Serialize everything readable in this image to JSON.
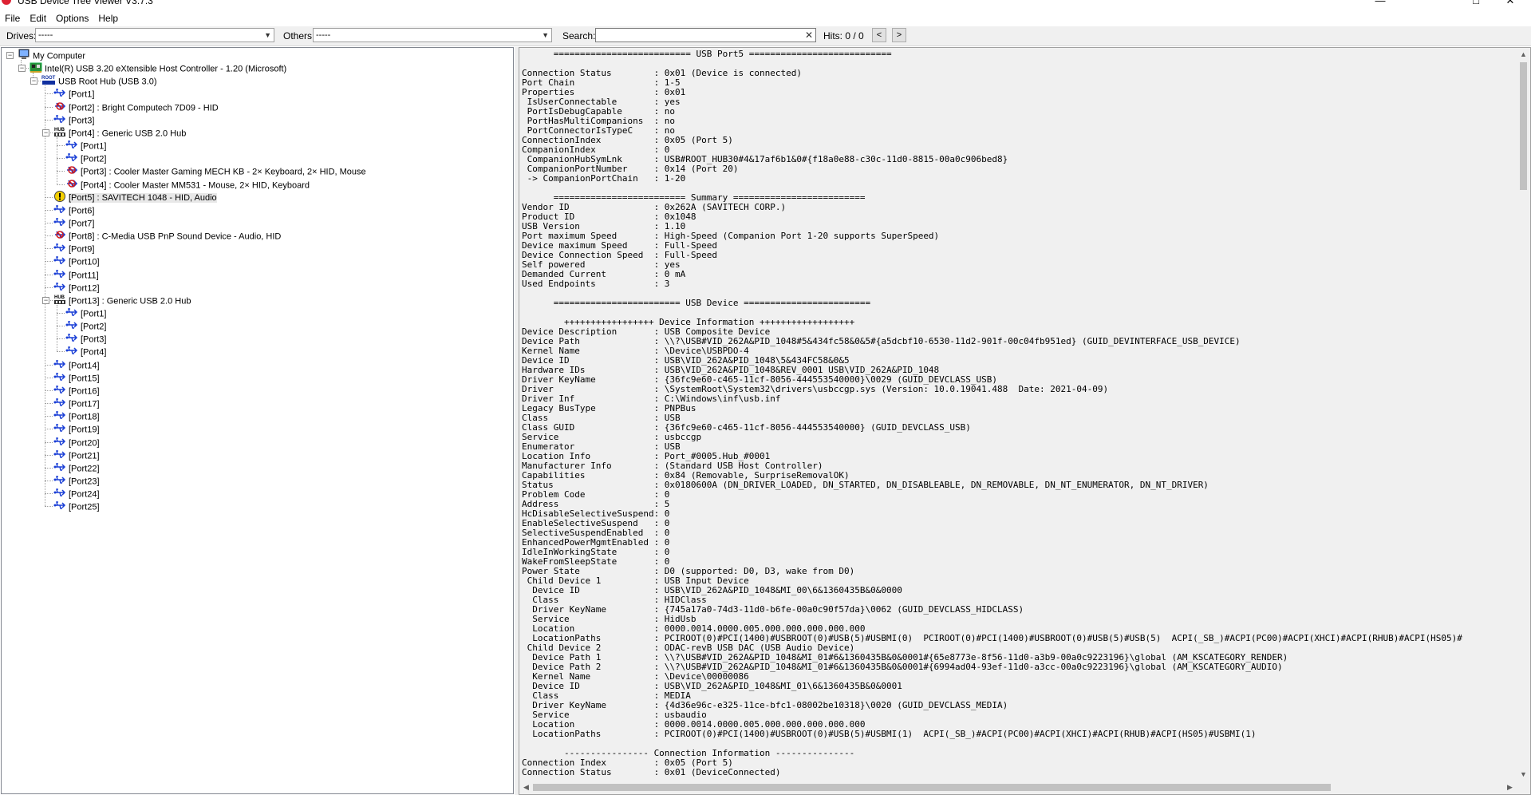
{
  "window": {
    "title": "USB Device Tree Viewer V3.7.3",
    "minimize": "—",
    "maximize": "□",
    "close": "✕"
  },
  "menu": [
    "File",
    "Edit",
    "Options",
    "Help"
  ],
  "toolbar": {
    "drives_label": "Drives:",
    "drives_value": "-----",
    "others_label": "Others:",
    "others_value": "-----",
    "search_label": "Search:",
    "search_value": "",
    "search_clear": "✕",
    "hits_text": "Hits: 0 / 0",
    "prev": "<",
    "next": ">"
  },
  "tree": [
    {
      "level": 0,
      "icon": "computer-icon",
      "label": "My Computer",
      "expanded": true
    },
    {
      "level": 1,
      "icon": "pci-controller-icon",
      "label": "Intel(R) USB 3.20 eXtensible Host Controller - 1.20 (Microsoft)",
      "expanded": true
    },
    {
      "level": 2,
      "icon": "root-hub-icon",
      "label": "USB Root Hub (USB 3.0)",
      "expanded": true
    },
    {
      "level": 3,
      "icon": "usb-port-icon",
      "label": "[Port1]"
    },
    {
      "level": 3,
      "icon": "usb-device-icon",
      "label": "[Port2] : Bright Computech 7D09 - HID"
    },
    {
      "level": 3,
      "icon": "usb-port-icon",
      "label": "[Port3]"
    },
    {
      "level": 3,
      "icon": "usb-hub-icon",
      "label": "[Port4] : Generic USB 2.0 Hub",
      "expanded": true
    },
    {
      "level": 4,
      "icon": "usb-port-icon",
      "label": "[Port1]"
    },
    {
      "level": 4,
      "icon": "usb-port-icon",
      "label": "[Port2]"
    },
    {
      "level": 4,
      "icon": "usb-device-icon",
      "label": "[Port3] : Cooler Master Gaming MECH KB - 2× Keyboard, 2× HID, Mouse"
    },
    {
      "level": 4,
      "icon": "usb-device-icon",
      "label": "[Port4] : Cooler Master MM531 - Mouse, 2× HID, Keyboard"
    },
    {
      "level": 3,
      "icon": "warning-icon",
      "label": "[Port5] : SAVITECH 1048 - HID, Audio",
      "selected": true
    },
    {
      "level": 3,
      "icon": "usb-port-icon",
      "label": "[Port6]"
    },
    {
      "level": 3,
      "icon": "usb-port-icon",
      "label": "[Port7]"
    },
    {
      "level": 3,
      "icon": "usb-device-icon",
      "label": "[Port8] : C-Media USB PnP Sound Device - Audio, HID"
    },
    {
      "level": 3,
      "icon": "usb-port-icon",
      "label": "[Port9]"
    },
    {
      "level": 3,
      "icon": "usb-port-icon",
      "label": "[Port10]"
    },
    {
      "level": 3,
      "icon": "usb-port-icon",
      "label": "[Port11]"
    },
    {
      "level": 3,
      "icon": "usb-port-icon",
      "label": "[Port12]"
    },
    {
      "level": 3,
      "icon": "usb-hub-icon",
      "label": "[Port13] : Generic USB 2.0 Hub",
      "expanded": true
    },
    {
      "level": 4,
      "icon": "usb-port-icon",
      "label": "[Port1]"
    },
    {
      "level": 4,
      "icon": "usb-port-icon",
      "label": "[Port2]"
    },
    {
      "level": 4,
      "icon": "usb-port-icon",
      "label": "[Port3]"
    },
    {
      "level": 4,
      "icon": "usb-port-icon",
      "label": "[Port4]"
    },
    {
      "level": 3,
      "icon": "usb-port-icon",
      "label": "[Port14]"
    },
    {
      "level": 3,
      "icon": "usb-port-icon",
      "label": "[Port15]"
    },
    {
      "level": 3,
      "icon": "usb-port-icon",
      "label": "[Port16]"
    },
    {
      "level": 3,
      "icon": "usb-port-icon",
      "label": "[Port17]"
    },
    {
      "level": 3,
      "icon": "usb-port-icon",
      "label": "[Port18]"
    },
    {
      "level": 3,
      "icon": "usb-port-icon",
      "label": "[Port19]"
    },
    {
      "level": 3,
      "icon": "usb-port-icon",
      "label": "[Port20]"
    },
    {
      "level": 3,
      "icon": "usb-port-icon",
      "label": "[Port21]"
    },
    {
      "level": 3,
      "icon": "usb-port-icon",
      "label": "[Port22]"
    },
    {
      "level": 3,
      "icon": "usb-port-icon",
      "label": "[Port23]"
    },
    {
      "level": 3,
      "icon": "usb-port-icon",
      "label": "[Port24]"
    },
    {
      "level": 3,
      "icon": "usb-port-icon",
      "label": "[Port25]"
    }
  ],
  "info_lines": [
    "      ========================== USB Port5 ===========================",
    "",
    "Connection Status        : 0x01 (Device is connected)",
    "Port Chain               : 1-5",
    "Properties               : 0x01",
    " IsUserConnectable       : yes",
    " PortIsDebugCapable      : no",
    " PortHasMultiCompanions  : no",
    " PortConnectorIsTypeC    : no",
    "ConnectionIndex          : 0x05 (Port 5)",
    "CompanionIndex           : 0",
    " CompanionHubSymLnk      : USB#ROOT_HUB30#4&17af6b1&0#{f18a0e88-c30c-11d0-8815-00a0c906bed8}",
    " CompanionPortNumber     : 0x14 (Port 20)",
    " -> CompanionPortChain   : 1-20",
    "",
    "      ========================= Summary =========================",
    "Vendor ID                : 0x262A (SAVITECH CORP.)",
    "Product ID               : 0x1048",
    "USB Version              : 1.10",
    "Port maximum Speed       : High-Speed (Companion Port 1-20 supports SuperSpeed)",
    "Device maximum Speed     : Full-Speed",
    "Device Connection Speed  : Full-Speed",
    "Self powered             : yes",
    "Demanded Current         : 0 mA",
    "Used Endpoints           : 3",
    "",
    "      ======================== USB Device ========================",
    "",
    "        +++++++++++++++++ Device Information ++++++++++++++++++",
    "Device Description       : USB Composite Device",
    "Device Path              : \\\\?\\USB#VID_262A&PID_1048#5&434fc58&0&5#{a5dcbf10-6530-11d2-901f-00c04fb951ed} (GUID_DEVINTERFACE_USB_DEVICE)",
    "Kernel Name              : \\Device\\USBPDO-4",
    "Device ID                : USB\\VID_262A&PID_1048\\5&434FC58&0&5",
    "Hardware IDs             : USB\\VID_262A&PID_1048&REV_0001 USB\\VID_262A&PID_1048",
    "Driver KeyName           : {36fc9e60-c465-11cf-8056-444553540000}\\0029 (GUID_DEVCLASS_USB)",
    "Driver                   : \\SystemRoot\\System32\\drivers\\usbccgp.sys (Version: 10.0.19041.488  Date: 2021-04-09)",
    "Driver Inf               : C:\\Windows\\inf\\usb.inf",
    "Legacy BusType           : PNPBus",
    "Class                    : USB",
    "Class GUID               : {36fc9e60-c465-11cf-8056-444553540000} (GUID_DEVCLASS_USB)",
    "Service                  : usbccgp",
    "Enumerator               : USB",
    "Location Info            : Port_#0005.Hub_#0001",
    "Manufacturer Info        : (Standard USB Host Controller)",
    "Capabilities             : 0x84 (Removable, SurpriseRemovalOK)",
    "Status                   : 0x0180600A (DN_DRIVER_LOADED, DN_STARTED, DN_DISABLEABLE, DN_REMOVABLE, DN_NT_ENUMERATOR, DN_NT_DRIVER)",
    "Problem Code             : 0",
    "Address                  : 5",
    "HcDisableSelectiveSuspend: 0",
    "EnableSelectiveSuspend   : 0",
    "SelectiveSuspendEnabled  : 0",
    "EnhancedPowerMgmtEnabled : 0",
    "IdleInWorkingState       : 0",
    "WakeFromSleepState       : 0",
    "Power State              : D0 (supported: D0, D3, wake from D0)",
    " Child Device 1          : USB Input Device",
    "  Device ID              : USB\\VID_262A&PID_1048&MI_00\\6&1360435B&0&0000",
    "  Class                  : HIDClass",
    "  Driver KeyName         : {745a17a0-74d3-11d0-b6fe-00a0c90f57da}\\0062 (GUID_DEVCLASS_HIDCLASS)",
    "  Service                : HidUsb",
    "  Location               : 0000.0014.0000.005.000.000.000.000.000",
    "  LocationPaths          : PCIROOT(0)#PCI(1400)#USBROOT(0)#USB(5)#USBMI(0)  PCIROOT(0)#PCI(1400)#USBROOT(0)#USB(5)#USB(5)  ACPI(_SB_)#ACPI(PC00)#ACPI(XHCI)#ACPI(RHUB)#ACPI(HS05)#",
    " Child Device 2          : ODAC-revB USB DAC (USB Audio Device)",
    "  Device Path 1          : \\\\?\\USB#VID_262A&PID_1048&MI_01#6&1360435B&0&0001#{65e8773e-8f56-11d0-a3b9-00a0c9223196}\\global (AM_KSCATEGORY_RENDER)",
    "  Device Path 2          : \\\\?\\USB#VID_262A&PID_1048&MI_01#6&1360435B&0&0001#{6994ad04-93ef-11d0-a3cc-00a0c9223196}\\global (AM_KSCATEGORY_AUDIO)",
    "  Kernel Name            : \\Device\\00000086",
    "  Device ID              : USB\\VID_262A&PID_1048&MI_01\\6&1360435B&0&0001",
    "  Class                  : MEDIA",
    "  Driver KeyName         : {4d36e96c-e325-11ce-bfc1-08002be10318}\\0020 (GUID_DEVCLASS_MEDIA)",
    "  Service                : usbaudio",
    "  Location               : 0000.0014.0000.005.000.000.000.000.000",
    "  LocationPaths          : PCIROOT(0)#PCI(1400)#USBROOT(0)#USB(5)#USBMI(1)  ACPI(_SB_)#ACPI(PC00)#ACPI(XHCI)#ACPI(RHUB)#ACPI(HS05)#USBMI(1)",
    "",
    "        ---------------- Connection Information ---------------",
    "Connection Index         : 0x05 (Port 5)",
    "Connection Status        : 0x01 (DeviceConnected)"
  ]
}
